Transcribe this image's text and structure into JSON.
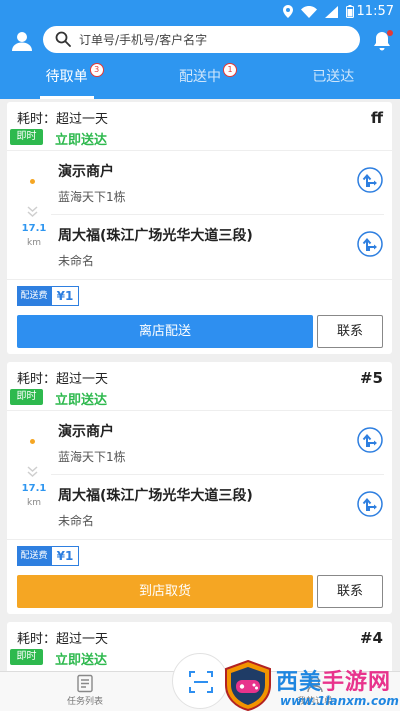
{
  "status_bar": {
    "time": "11:57"
  },
  "header": {
    "search_placeholder": "订单号/手机号/客户名字",
    "tabs": [
      {
        "label": "待取单",
        "badge": "3",
        "active": true
      },
      {
        "label": "配送中",
        "badge": "1",
        "active": false
      },
      {
        "label": "已送达",
        "badge": "",
        "active": false
      }
    ]
  },
  "orders": [
    {
      "elapsed": "耗时：超过一天",
      "order_no": "ff",
      "badge": "即时",
      "delivery_type": "立即送达",
      "pickup_name": "演示商户",
      "pickup_addr": "蓝海天下1栋",
      "distance": "17.1",
      "distance_unit": "km",
      "dropoff_name": "周大福(珠江广场光华大道三段)",
      "dropoff_addr": "未命名",
      "fee_label": "配送费",
      "fee_value": "¥1",
      "primary_action": "离店配送",
      "contact": "联系"
    },
    {
      "elapsed": "耗时：超过一天",
      "order_no": "#5",
      "badge": "即时",
      "delivery_type": "立即送达",
      "pickup_name": "演示商户",
      "pickup_addr": "蓝海天下1栋",
      "distance": "17.1",
      "distance_unit": "km",
      "dropoff_name": "周大福(珠江广场光华大道三段)",
      "dropoff_addr": "未命名",
      "fee_label": "配送费",
      "fee_value": "¥1",
      "primary_action": "到店取货",
      "contact": "联系"
    },
    {
      "elapsed": "耗时：超过一天",
      "order_no": "#4",
      "badge": "即时",
      "delivery_type": "立即送达"
    }
  ],
  "bottom_nav": {
    "tasks_label": "任务列表",
    "mine_label": "我的订单"
  },
  "watermark": {
    "title_a": "西美",
    "title_b": "手游网",
    "url": "www.1lanxm.com"
  },
  "colors": {
    "primary": "#2e96f0",
    "green": "#2eb94e",
    "orange": "#f5a623",
    "red": "#e53935"
  }
}
